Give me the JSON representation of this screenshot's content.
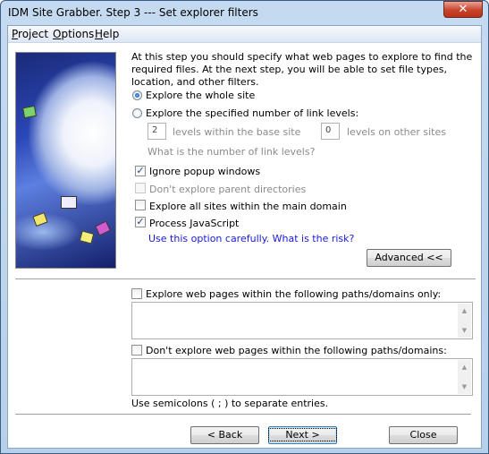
{
  "window": {
    "title": "IDM Site Grabber. Step 3 --- Set explorer filters",
    "close_icon": "close-x-icon",
    "close_glyph": "✕"
  },
  "menu": {
    "items": [
      {
        "label": "Project",
        "accel": "P",
        "rest": "roject"
      },
      {
        "label": "Options",
        "accel": "O",
        "rest": "ptions"
      },
      {
        "label": "Help",
        "accel": "H",
        "rest": "elp"
      }
    ]
  },
  "intro": "At this step you should specify what web pages to explore to find the required files. At the next step, you will be able to set file types, location, and other filters.",
  "explore_mode": {
    "options": [
      {
        "label": "Explore the whole site",
        "selected": true
      },
      {
        "label": "Explore the specified number of link levels:",
        "selected": false
      }
    ],
    "levels_base_value": "2",
    "levels_base_label": "levels within the base site",
    "levels_other_value": "0",
    "levels_other_label": "levels on other sites",
    "levels_help": "What is the number of link levels?"
  },
  "options": {
    "ignore_popup": {
      "label": "Ignore popup windows",
      "checked": true,
      "mark": "✓"
    },
    "no_parent": {
      "label": "Don't explore parent directories",
      "checked": false,
      "disabled": true
    },
    "all_sites_domain": {
      "label": "Explore all sites within the main domain",
      "checked": false
    },
    "process_js": {
      "label": "Process JavaScript",
      "checked": true,
      "mark": "✓"
    },
    "js_warning_link": "Use this option carefully. What is the risk?"
  },
  "advanced_button": "Advanced <<",
  "paths": {
    "include_label": "Explore web pages within the following paths/domains only:",
    "include_checked": false,
    "include_value": "",
    "exclude_label": "Don't explore web pages within the following paths/domains:",
    "exclude_checked": false,
    "exclude_value": "",
    "hint": "Use semicolons ( ; ) to separate entries.",
    "scroll_up": "▲",
    "scroll_down": "▼"
  },
  "footer": {
    "back": "< Back",
    "next": "Next >",
    "close": "Close"
  }
}
